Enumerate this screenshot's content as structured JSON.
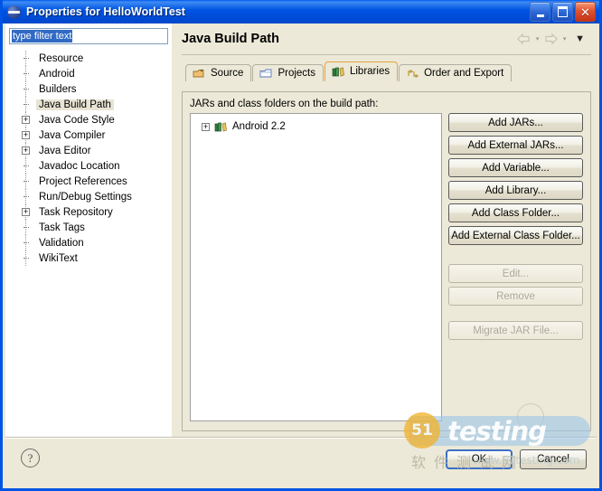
{
  "window": {
    "title": "Properties for HelloWorldTest",
    "icon": "eclipse-globe-icon",
    "controls": {
      "minimize": "_",
      "maximize": "□",
      "close": "✕"
    }
  },
  "sidebar": {
    "filter": {
      "value": "type filter text",
      "placeholder": "type filter text"
    },
    "items": [
      {
        "label": "Resource",
        "expandable": false,
        "selected": false
      },
      {
        "label": "Android",
        "expandable": false,
        "selected": false
      },
      {
        "label": "Builders",
        "expandable": false,
        "selected": false
      },
      {
        "label": "Java Build Path",
        "expandable": false,
        "selected": true
      },
      {
        "label": "Java Code Style",
        "expandable": true,
        "selected": false
      },
      {
        "label": "Java Compiler",
        "expandable": true,
        "selected": false
      },
      {
        "label": "Java Editor",
        "expandable": true,
        "selected": false
      },
      {
        "label": "Javadoc Location",
        "expandable": false,
        "selected": false
      },
      {
        "label": "Project References",
        "expandable": false,
        "selected": false
      },
      {
        "label": "Run/Debug Settings",
        "expandable": false,
        "selected": false
      },
      {
        "label": "Task Repository",
        "expandable": true,
        "selected": false
      },
      {
        "label": "Task Tags",
        "expandable": false,
        "selected": false
      },
      {
        "label": "Validation",
        "expandable": false,
        "selected": false
      },
      {
        "label": "WikiText",
        "expandable": false,
        "selected": false
      }
    ]
  },
  "page": {
    "title": "Java Build Path",
    "nav": {
      "back_icon": "back-arrow-icon",
      "back_caret": "▾",
      "forward_icon": "forward-arrow-icon",
      "forward_caret": "▾",
      "menu_caret": "▼"
    },
    "tabs": [
      {
        "label": "Source",
        "icon": "source-folder-icon",
        "active": false
      },
      {
        "label": "Projects",
        "icon": "projects-folder-icon",
        "active": false
      },
      {
        "label": "Libraries",
        "icon": "libraries-books-icon",
        "active": true
      },
      {
        "label": "Order and Export",
        "icon": "order-export-icon",
        "active": false
      }
    ],
    "panel": {
      "label": "JARs and class folders on the build path:",
      "list": [
        {
          "label": "Android 2.2",
          "icon": "library-books-icon",
          "expander": "+"
        }
      ],
      "buttons": [
        {
          "label": "Add JARs...",
          "enabled": true,
          "name": "add-jars-button"
        },
        {
          "label": "Add External JARs...",
          "enabled": true,
          "name": "add-external-jars-button"
        },
        {
          "label": "Add Variable...",
          "enabled": true,
          "name": "add-variable-button"
        },
        {
          "label": "Add Library...",
          "enabled": true,
          "name": "add-library-button"
        },
        {
          "label": "Add Class Folder...",
          "enabled": true,
          "name": "add-class-folder-button"
        },
        {
          "label": "Add External Class Folder...",
          "enabled": true,
          "name": "add-external-class-folder-button"
        },
        {
          "label": "Edit...",
          "enabled": false,
          "name": "edit-button"
        },
        {
          "label": "Remove",
          "enabled": false,
          "name": "remove-button"
        },
        {
          "label": "Migrate JAR File...",
          "enabled": false,
          "name": "migrate-jar-file-button"
        }
      ]
    }
  },
  "footer": {
    "help_icon": "question-mark-help-icon",
    "ok_label": "OK",
    "cancel_label": "Cancel"
  },
  "watermark": {
    "badge": "51",
    "text": "testing",
    "chinese": "软件测试网",
    "url": "www.51testing.com"
  },
  "colors": {
    "titlebar_blue": "#0054e3",
    "dialog_face": "#ece9d8",
    "selection_blue": "#316ac5",
    "tab_active_border": "#e8a33d",
    "tree_selection": "#e8e4d4",
    "default_button_border": "#3c6fc4"
  }
}
